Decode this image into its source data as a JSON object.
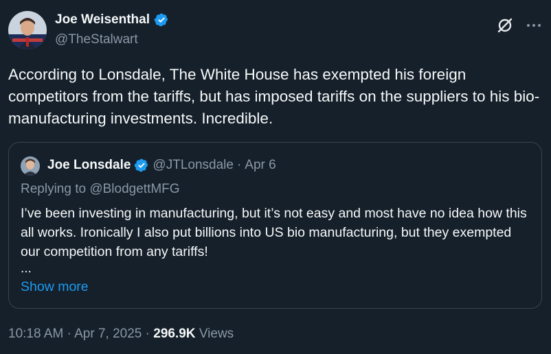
{
  "tweet": {
    "author_name": "Joe Weisenthal",
    "author_handle": "@TheStalwart",
    "text": "According to Lonsdale, The White House has exempted his foreign competitors from the tariffs, but has imposed tariffs on the suppliers to his bio-manufacturing investments. Incredible.",
    "time": "10:18 AM",
    "date": "Apr 7, 2025",
    "views_count": "296.9K",
    "views_label": "Views",
    "separator": " · "
  },
  "quoted": {
    "author_name": "Joe Lonsdale",
    "author_handle": "@JTLonsdale",
    "date": "Apr 6",
    "replying_to": "Replying to @BlodgettMFG",
    "text": "I’ve been investing in manufacturing, but it’s not easy and most have no idea how this all works. Ironically I also put billions into US bio manufacturing, but they exempted our competition from any tariffs!",
    "ellipsis": "...",
    "show_more": "Show more"
  },
  "colors": {
    "background": "#15202b",
    "text": "#f7f9f9",
    "secondary": "#8b98a5",
    "accent": "#1d9bf0",
    "border": "#38444d"
  },
  "icons": {
    "verified": "verified-badge-icon",
    "grok": "grok-icon",
    "more": "more-icon"
  }
}
